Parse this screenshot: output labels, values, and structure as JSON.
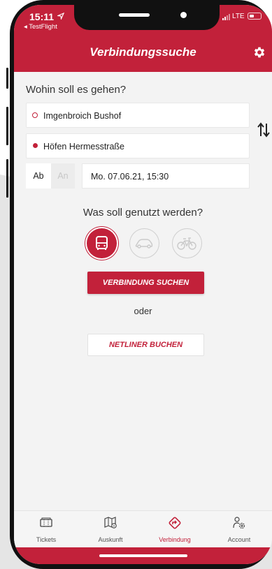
{
  "status_bar": {
    "time": "15:11",
    "back_app": "◂ TestFlight",
    "network": "LTE"
  },
  "header": {
    "title": "Verbindungssuche"
  },
  "search": {
    "question": "Wohin soll es gehen?",
    "from": "Imgenbroich Bushof",
    "to": "Höfen Hermesstraße",
    "mode_ab": "Ab",
    "mode_an": "An",
    "datetime": "Mo. 07.06.21, 15:30"
  },
  "transport": {
    "question": "Was soll genutzt werden?",
    "options": [
      "bus-icon",
      "car-icon",
      "bike-icon"
    ],
    "selected": "bus"
  },
  "actions": {
    "search_label": "VERBINDUNG SUCHEN",
    "or_label": "oder",
    "netliner_label": "NETLINER BUCHEN"
  },
  "tabs": [
    {
      "label": "Tickets",
      "icon": "ticket-icon"
    },
    {
      "label": "Auskunft",
      "icon": "map-info-icon"
    },
    {
      "label": "Verbindung",
      "icon": "directions-icon",
      "active": true
    },
    {
      "label": "Account",
      "icon": "account-settings-icon"
    }
  ],
  "colors": {
    "accent": "#c2213a",
    "background": "#f3f3f3",
    "frame": "#111111"
  }
}
